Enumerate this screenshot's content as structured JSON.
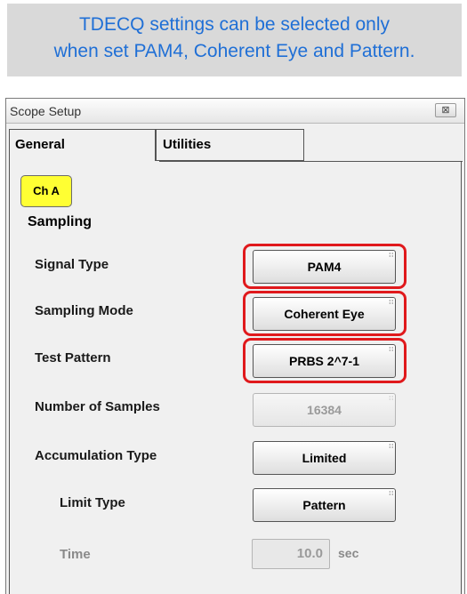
{
  "note": {
    "line1": "TDECQ settings can be selected only",
    "line2": "when set PAM4, Coherent Eye and Pattern."
  },
  "window": {
    "title": "Scope Setup",
    "close_glyph": "⊠"
  },
  "tabs": [
    {
      "label": "General",
      "active": true
    },
    {
      "label": "Utilities",
      "active": false
    }
  ],
  "channel": {
    "label": "Ch A",
    "color": "#ffff33"
  },
  "sampling": {
    "section_title": "Sampling",
    "rows": [
      {
        "label": "Signal Type",
        "value": "PAM4",
        "enabled": true,
        "highlighted": true
      },
      {
        "label": "Sampling Mode",
        "value": "Coherent Eye",
        "enabled": true,
        "highlighted": true
      },
      {
        "label": "Test Pattern",
        "value": "PRBS 2^7-1",
        "enabled": true,
        "highlighted": true
      },
      {
        "label": "Number of Samples",
        "value": "16384",
        "enabled": false,
        "highlighted": false
      },
      {
        "label": "Accumulation Type",
        "value": "Limited",
        "enabled": true,
        "highlighted": false
      },
      {
        "label": "Limit Type",
        "value": "Pattern",
        "enabled": true,
        "highlighted": false
      }
    ],
    "time": {
      "label": "Time",
      "value": "10.0",
      "unit": "sec",
      "enabled": false
    }
  },
  "colors": {
    "note_text": "#1f6fd6",
    "highlight": "#e0191c",
    "channel_button": "#ffff33"
  }
}
